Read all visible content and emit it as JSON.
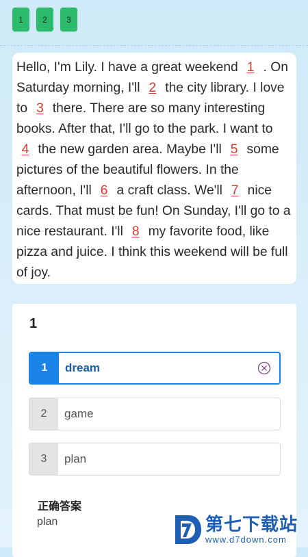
{
  "tabs": [
    {
      "label": "1"
    },
    {
      "label": "2"
    },
    {
      "label": "3"
    }
  ],
  "passage": {
    "segments": [
      "Hello, I'm Lily. I have a great weekend ",
      " . On Saturday morning, I'll ",
      " the city library. I love to ",
      " there. There are so many interesting books. After that, I'll go to the park. I want to ",
      " the new garden area. Maybe I'll ",
      " some pictures of the beautiful flowers. In the afternoon, I'll ",
      " a craft class. We'll ",
      " nice cards. That must be fun! On Sunday, I'll go to a nice restaurant. I'll ",
      " my favorite food, like pizza and juice. I think this weekend will be full of joy."
    ],
    "blanks": [
      "1",
      "2",
      "3",
      "4",
      "5",
      "6",
      "7",
      "8"
    ],
    "blank_color": "#d63a2f"
  },
  "question": {
    "number": "1",
    "options": [
      {
        "index": "1",
        "text": "dream",
        "selected": true
      },
      {
        "index": "2",
        "text": "game",
        "selected": false
      },
      {
        "index": "3",
        "text": "plan",
        "selected": false
      }
    ],
    "selected_color": "#1a84e6",
    "clear_icon": "circle-x-icon",
    "answer_label": "正确答案",
    "answer_value": "plan"
  },
  "watermark": {
    "title": "第七下载站",
    "url": "www.d7down.com"
  },
  "colors": {
    "tab": "#2bbb6b",
    "background": "#d8eef9"
  }
}
